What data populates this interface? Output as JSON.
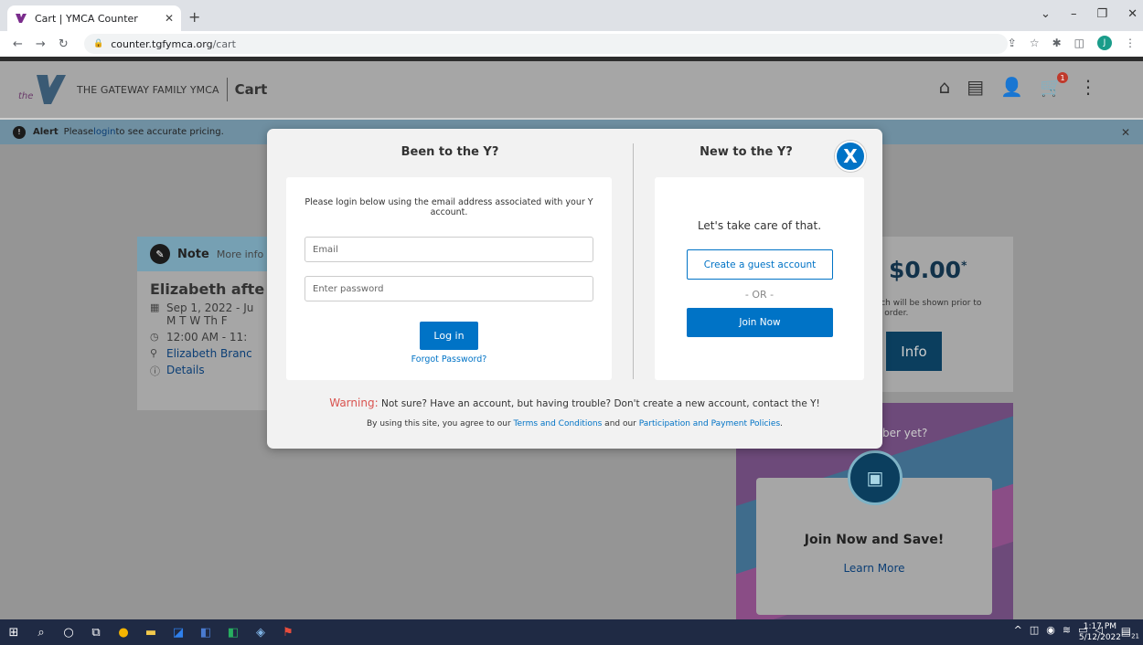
{
  "browser": {
    "tab_title": "Cart | YMCA Counter",
    "tab_close": "✕",
    "new_tab": "+",
    "url_domain": "counter.tgfymca.org",
    "url_path": "/cart",
    "profile_initial": "J"
  },
  "header": {
    "logo_text": "the",
    "brand": "THE GATEWAY FAMILY YMCA",
    "page_name": "Cart",
    "cart_count": "1"
  },
  "alert": {
    "label": "Alert",
    "text_before": "Please ",
    "link": "login",
    "text_after": " to see accurate pricing."
  },
  "note_card": {
    "label": "Note",
    "more": "More info",
    "title": "Elizabeth afte",
    "dates": "Sep 1, 2022 - Ju",
    "days": "M T W Th F",
    "time": "12:00 AM - 11:",
    "location": "Elizabeth Branc",
    "details": "Details"
  },
  "price_panel": {
    "amount": "$0.00",
    "asterisk": "*",
    "note_line1": "hich will be shown prior to",
    "note_line2": "ur order.",
    "info_label": "Info"
  },
  "member_panel": {
    "question": "ber yet?",
    "title": "Join Now and Save!",
    "link": "Learn More"
  },
  "modal": {
    "left_title": "Been to the Y?",
    "right_title": "New to the Y?",
    "close_label": "X",
    "intro": "Please login below using the email address associated with your Y account.",
    "email_placeholder": "Email",
    "password_placeholder": "Enter password",
    "login_label": "Log in",
    "forgot_label": "Forgot Password?",
    "take_care": "Let's take care of that.",
    "guest_label": "Create a guest account",
    "or_label": "- OR -",
    "join_label": "Join Now",
    "warning_label": "Warning:",
    "warning_text": " Not sure? Have an account, but having trouble? Don't create a new account, contact the Y!",
    "terms_before": "By using this site, you agree to our ",
    "terms_link": "Terms and Conditions",
    "terms_mid": " and our ",
    "policies_link": "Participation and Payment Policies",
    "terms_after": "."
  },
  "taskbar": {
    "time": "1:17 PM",
    "date": "5/12/2022",
    "notif_count": "21"
  },
  "colors": {
    "accent": "#0073c6",
    "warning": "#d9534f"
  }
}
